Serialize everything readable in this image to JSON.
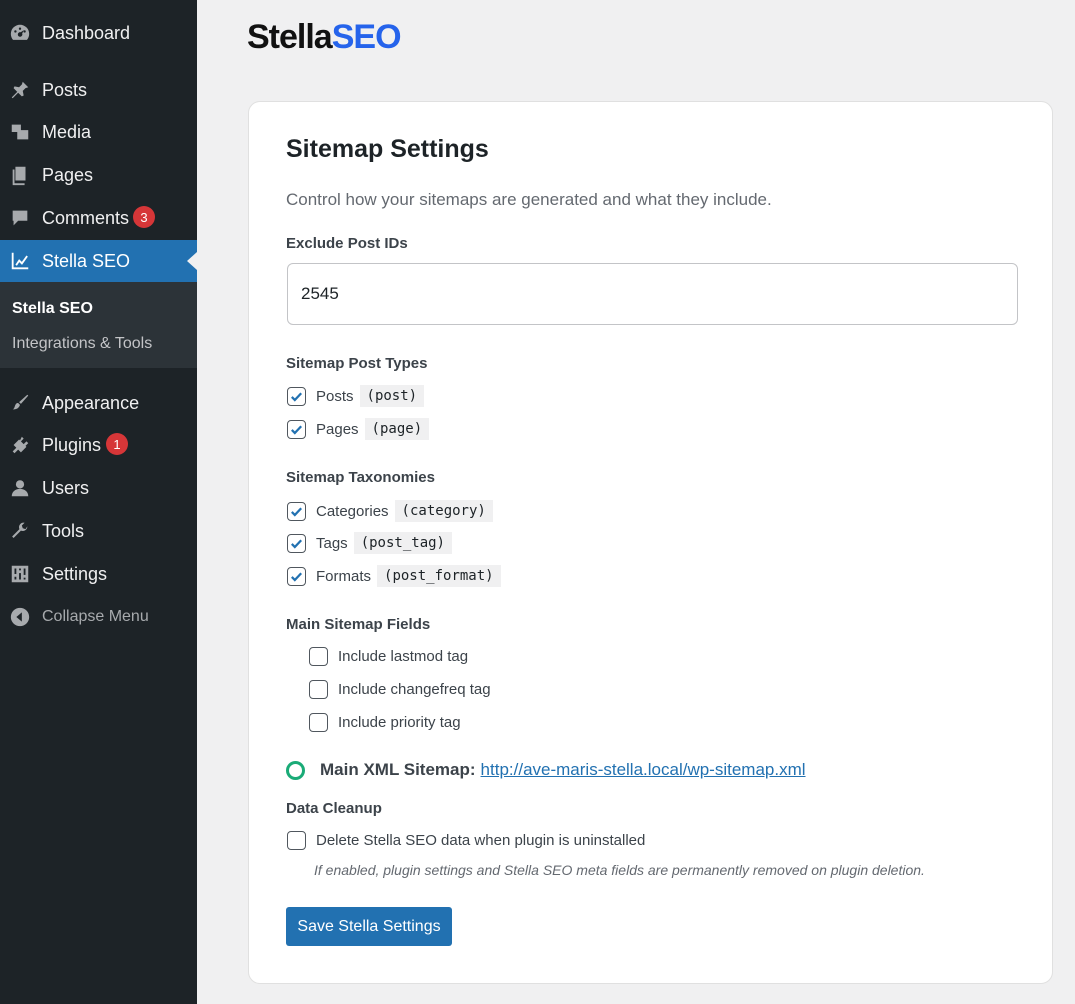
{
  "sidebar": {
    "items": [
      {
        "label": "Dashboard",
        "icon": "dashboard-icon"
      },
      {
        "label": "Posts",
        "icon": "pin-icon"
      },
      {
        "label": "Media",
        "icon": "media-icon"
      },
      {
        "label": "Pages",
        "icon": "pages-icon"
      },
      {
        "label": "Comments",
        "icon": "comment-icon",
        "badge": "3"
      },
      {
        "label": "Stella SEO",
        "icon": "chart-line-icon"
      },
      {
        "label": "Appearance",
        "icon": "paintbrush-icon"
      },
      {
        "label": "Plugins",
        "icon": "plugin-icon",
        "badge": "1"
      },
      {
        "label": "Users",
        "icon": "user-icon"
      },
      {
        "label": "Tools",
        "icon": "wrench-icon"
      },
      {
        "label": "Settings",
        "icon": "settings-sliders-icon"
      },
      {
        "label": "Collapse Menu",
        "icon": "collapse-icon"
      }
    ],
    "submenu": [
      "Stella SEO",
      "Integrations & Tools"
    ]
  },
  "brand": {
    "part1": "Stella",
    "part2": "SEO",
    "accent": "#2563eb"
  },
  "card": {
    "title": "Sitemap Settings",
    "description": "Control how your sitemaps are generated and what they include.",
    "exclude": {
      "label": "Exclude Post IDs",
      "value": "2545"
    },
    "post_types": {
      "label": "Sitemap Post Types",
      "items": [
        {
          "label": "Posts",
          "code": "(post)",
          "checked": true
        },
        {
          "label": "Pages",
          "code": "(page)",
          "checked": true
        }
      ]
    },
    "taxonomies": {
      "label": "Sitemap Taxonomies",
      "items": [
        {
          "label": "Categories",
          "code": "(category)",
          "checked": true
        },
        {
          "label": "Tags",
          "code": "(post_tag)",
          "checked": true
        },
        {
          "label": "Formats",
          "code": "(post_format)",
          "checked": true
        }
      ]
    },
    "fields": {
      "label": "Main Sitemap Fields",
      "items": [
        {
          "label": "Include lastmod tag",
          "checked": false
        },
        {
          "label": "Include changefreq tag",
          "checked": false
        },
        {
          "label": "Include priority tag",
          "checked": false
        }
      ]
    },
    "sitemap": {
      "label": "Main XML Sitemap:",
      "url": "http://ave-maris-stella.local/wp-sitemap.xml"
    },
    "cleanup": {
      "label": "Data Cleanup",
      "option": "Delete Stella SEO data when plugin is uninstalled",
      "checked": false,
      "note": "If enabled, plugin settings and Stella SEO meta fields are permanently removed on plugin deletion."
    },
    "save_label": "Save Stella Settings"
  },
  "colors": {
    "sidebar_bg": "#1d2327",
    "active": "#2271b1",
    "badge": "#d63638",
    "ring": "#1aab77"
  }
}
